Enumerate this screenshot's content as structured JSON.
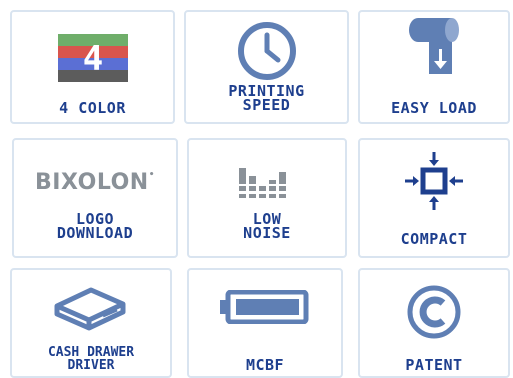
{
  "features": [
    {
      "id": "4-color",
      "label": "4 COLOR",
      "badge": "4",
      "colors": [
        "#6fae6a",
        "#d9554d",
        "#5b6fd4",
        "#5c5c5c"
      ]
    },
    {
      "id": "printing-speed",
      "label": "PRINTING\nSPEED"
    },
    {
      "id": "easy-load",
      "label": "EASY LOAD"
    },
    {
      "id": "logo-download",
      "label": "LOGO\nDOWNLOAD",
      "logo_text": "BIXOLON"
    },
    {
      "id": "low-noise",
      "label": "LOW\nNOISE"
    },
    {
      "id": "compact",
      "label": "COMPACT"
    },
    {
      "id": "cash-drawer-driver",
      "label": "CASH DRAWER\nDRIVER"
    },
    {
      "id": "mcbf",
      "label": "MCBF"
    },
    {
      "id": "patent",
      "label": "PATENT"
    }
  ],
  "colors": {
    "icon_blue": "#5f7fb4",
    "label_navy": "#1e3f8e",
    "tile_border": "#d9e4f0",
    "logo_gray": "#8a9198"
  }
}
